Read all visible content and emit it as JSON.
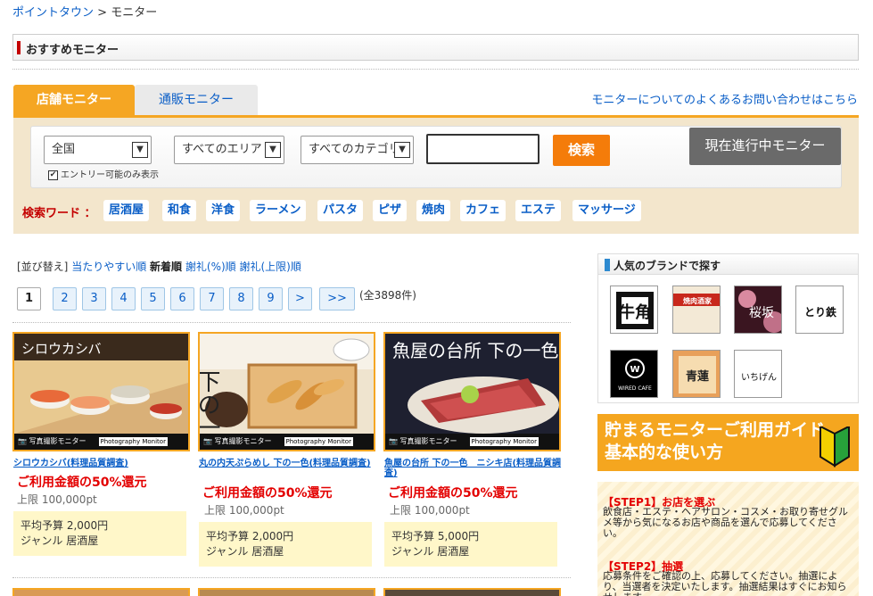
{
  "breadcrumb": {
    "home": "ポイントタウン",
    "separator": " > ",
    "current": "モニター"
  },
  "section_title": "おすすめモニター",
  "tabs": [
    {
      "label": "店舗モニター",
      "active": true
    },
    {
      "label": "通販モニター",
      "active": false
    }
  ],
  "faq_link": "モニターについてのよくあるお問い合わせはこちら",
  "search": {
    "region": "全国",
    "area": "すべてのエリア",
    "category": "すべてのカテゴリ",
    "keyword": "",
    "button": "検索",
    "entry_only_label": "エントリー可能のみ表示",
    "entry_only_checked": true,
    "current_button": "現在進行中モニター"
  },
  "keywords": {
    "label": "検索ワード ：",
    "items": [
      "居酒屋",
      "和食",
      "洋食",
      "ラーメン",
      "パスタ",
      "ピザ",
      "焼肉",
      "カフェ",
      "エステ",
      "マッサージ"
    ]
  },
  "sort": {
    "label": "[並び替え]",
    "options": [
      "当たりやすい順",
      "新着順",
      "謝礼(%)順",
      "謝礼(上限)順"
    ],
    "current": "新着順"
  },
  "pagination": {
    "pages": [
      "1",
      "2",
      "3",
      "4",
      "5",
      "6",
      "7",
      "8",
      "9",
      ">",
      ">>"
    ],
    "active": "1",
    "total": "(全3898件)"
  },
  "monitors": [
    {
      "banner_text": "シロウカシバ",
      "strip_label": "写真撮影モニター",
      "strip_tag": "Photography Monitor",
      "name": "シロウカシバ(料理品質調査)",
      "rate": "ご利用金額の50%還元",
      "limit": "上限 100,000pt",
      "budget": "平均予算 2,000円",
      "genre": "ジャンル 居酒屋"
    },
    {
      "banner_text": "下の一色",
      "strip_label": "写真撮影モニター",
      "strip_tag": "Photography Monitor",
      "name": "丸の内天ぷらめし 下の一色(料理品質調査)",
      "rate": "ご利用金額の50%還元",
      "limit": "上限 100,000pt",
      "budget": "平均予算 2,000円",
      "genre": "ジャンル 居酒屋"
    },
    {
      "banner_text": "魚屋の台所 下の一色",
      "strip_label": "写真撮影モニター",
      "strip_tag": "Photography Monitor",
      "name": "魚屋の台所 下の一色　ニシキ店(料理品質調査)",
      "rate": "ご利用金額の50%還元",
      "limit": "上限 100,000pt",
      "budget": "平均予算 5,000円",
      "genre": "ジャンル 居酒屋"
    }
  ],
  "brands": {
    "title": "人気のブランドで探す",
    "logos": [
      "牛角",
      "焼肉酒家",
      "桜坂",
      "とり鉄",
      "WIRED CAFE",
      "青蓮",
      "いちげん"
    ]
  },
  "guide": {
    "line1": "貯まるモニターご利用ガイド",
    "line2": "基本的な使い方"
  },
  "steps": [
    {
      "title": "【STEP1】お店を選ぶ",
      "text": "飲食店・エステ・ヘアサロン・コスメ・お取り寄せグルメ等から気になるお店や商品を選んで応募してください。"
    },
    {
      "title": "【STEP2】抽選",
      "text": "応募条件をご確認の上、応募してください。抽選により、当選者を決定いたします。抽選結果はすぐにお知らせします。"
    }
  ],
  "colors": {
    "accent": "#f5a623",
    "link": "#0a5ec7",
    "highlight": "#e30000",
    "panel": "#f3e6cc"
  }
}
